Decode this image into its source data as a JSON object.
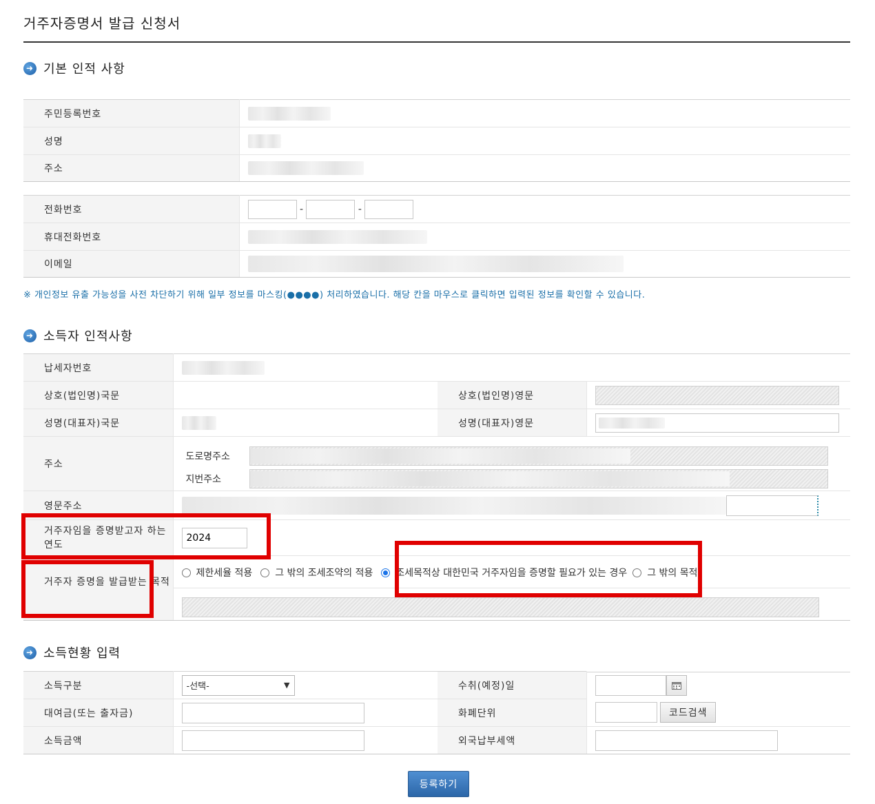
{
  "page": {
    "title": "거주자증명서 발급 신청서"
  },
  "sections": {
    "basic": "기본 인적 사항",
    "income_person": "소득자 인적사항",
    "income_status": "소득현황 입력"
  },
  "basic": {
    "rrn_label": "주민등록번호",
    "name_label": "성명",
    "address_label": "주소",
    "phone_label": "전화번호",
    "mobile_label": "휴대전화번호",
    "email_label": "이메일",
    "dash": "-"
  },
  "notice": "※ 개인정보 유출 가능성을 사전 차단하기 위해 일부 정보를 마스킹(●●●●) 처리하였습니다. 해당 칸을 마우스로 클릭하면 입력된 정보를 확인할 수 있습니다.",
  "income_person": {
    "tax_id_label": "납세자번호",
    "company_kr_label": "상호(법인명)국문",
    "company_en_label": "상호(법인명)영문",
    "rep_kr_label": "성명(대표자)국문",
    "rep_en_label": "성명(대표자)영문",
    "address_label": "주소",
    "road_label": "도로명주소",
    "lot_label": "지번주소",
    "en_address_label": "영문주소",
    "year_label": "거주자임을 증명받고자 하는 연도",
    "year_value": "2024",
    "purpose_label": "거주자 증명을 발급받는 목적",
    "purpose_options": [
      {
        "label": "제한세율 적용",
        "selected": false
      },
      {
        "label": "그 밖의 조세조약의 적용",
        "selected": false
      },
      {
        "label": "조세목적상 대한민국 거주자임을 증명할 필요가 있는 경우",
        "selected": true
      },
      {
        "label": "그 밖의 목적",
        "selected": false
      }
    ]
  },
  "income_status": {
    "type_label": "소득구분",
    "type_selected": "-선택-",
    "date_label": "수취(예정)일",
    "loan_label": "대여금(또는 출자금)",
    "currency_label": "화폐단위",
    "code_search": "코드검색",
    "amount_label": "소득금액",
    "foreign_tax_label": "외국납부세액"
  },
  "submit_label": "등록하기",
  "colors": {
    "highlight": "#e00000",
    "accent": "#2c66a8",
    "notice": "#1a6fa8"
  }
}
